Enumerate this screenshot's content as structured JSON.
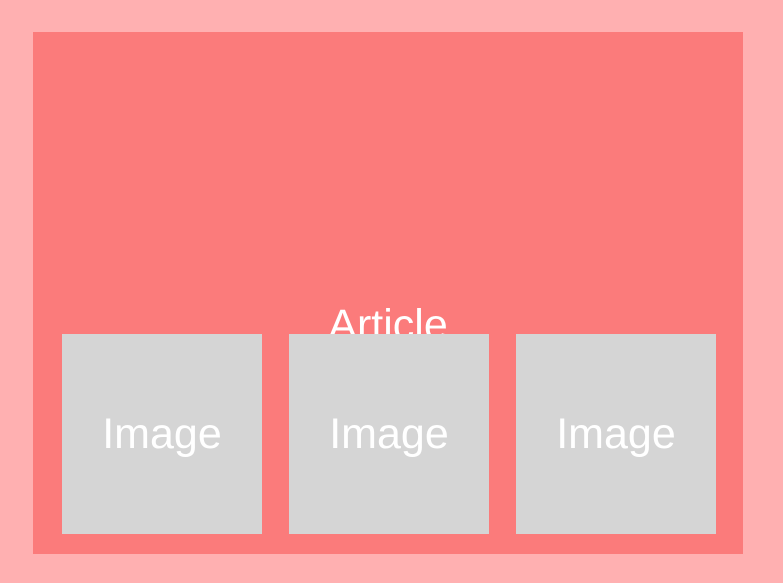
{
  "article": {
    "label": "Article"
  },
  "images": [
    {
      "label": "Image"
    },
    {
      "label": "Image"
    },
    {
      "label": "Image"
    }
  ],
  "colors": {
    "page_background": "#ffb0b1",
    "article_background": "#fb7b7b",
    "image_background": "#d5d5d5",
    "text": "#ffffff"
  }
}
